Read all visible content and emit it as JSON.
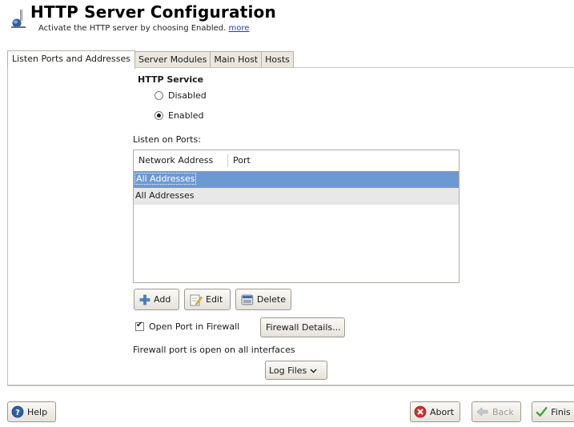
{
  "header": {
    "title": "HTTP Server Configuration",
    "subtitle": "Activate the HTTP server by choosing Enabled.",
    "more_link": "more"
  },
  "tabs": [
    {
      "label": "Listen Ports and Addresses",
      "active": true
    },
    {
      "label": "Server Modules",
      "active": false
    },
    {
      "label": "Main Host",
      "active": false
    },
    {
      "label": "Hosts",
      "active": false
    }
  ],
  "http_service": {
    "title": "HTTP Service",
    "options": [
      {
        "label": "Disabled",
        "checked": false
      },
      {
        "label": "Enabled",
        "checked": true
      }
    ]
  },
  "listen": {
    "label": "Listen on Ports:",
    "columns": [
      "Network Address",
      "Port"
    ],
    "rows": [
      {
        "address": "All Addresses",
        "port": "",
        "selected": true
      },
      {
        "address": "All Addresses",
        "port": "",
        "selected": false
      }
    ]
  },
  "actions": {
    "add": "Add",
    "edit": "Edit",
    "delete": "Delete"
  },
  "firewall": {
    "open_port_label": "Open Port in Firewall",
    "open_port_checked": true,
    "details_button": "Firewall Details...",
    "status": "Firewall port is open on all interfaces"
  },
  "log_files": {
    "label": "Log Files"
  },
  "footer": {
    "help": "Help",
    "abort": "Abort",
    "back": "Back",
    "finish": "Finish"
  },
  "colors": {
    "selection": "#6d99d3",
    "link": "#1f3fbf",
    "abort_icon": "#d0312d",
    "finish_icon": "#3fa83a"
  }
}
